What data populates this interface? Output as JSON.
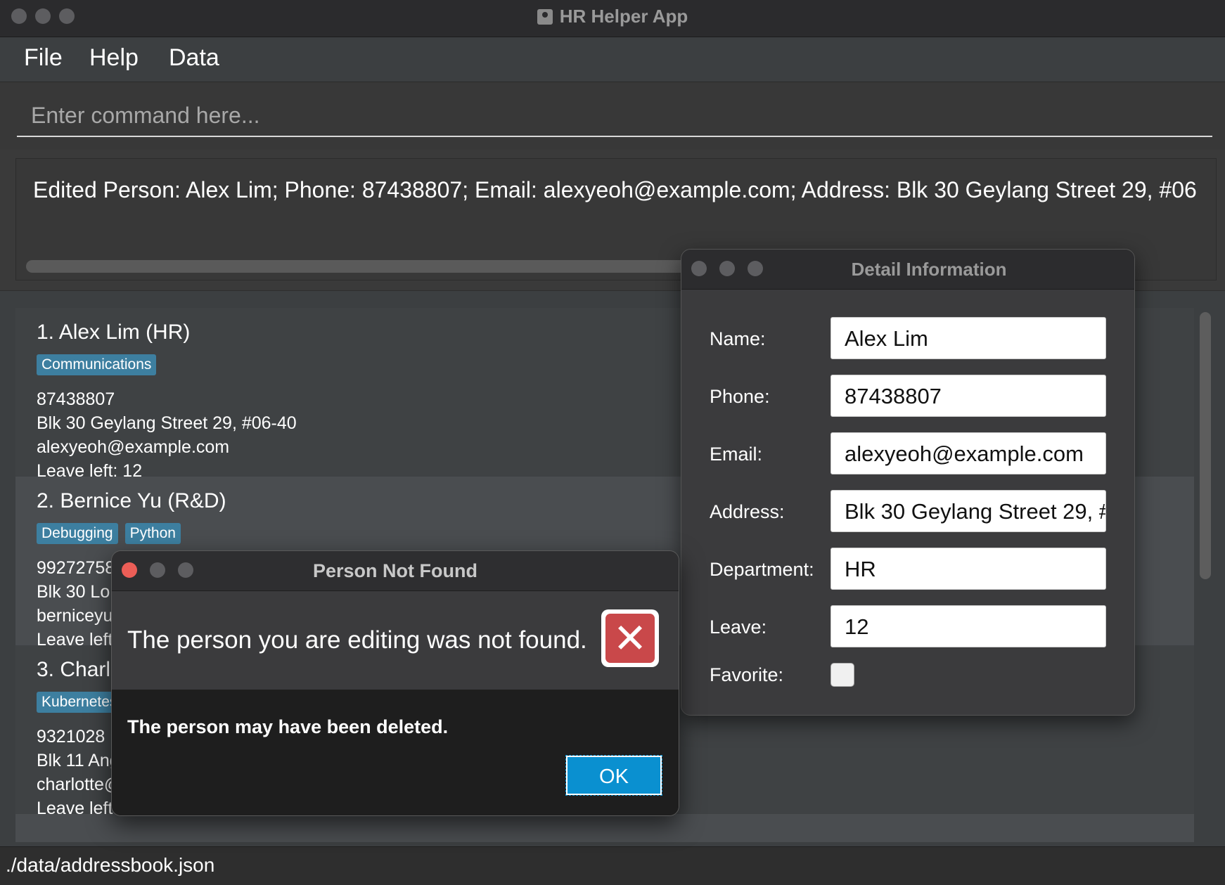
{
  "window": {
    "title": "HR Helper App"
  },
  "menu": {
    "items": [
      "File",
      "Help",
      "Data"
    ]
  },
  "command": {
    "placeholder": "Enter command here..."
  },
  "result": {
    "text": "Edited Person: Alex Lim; Phone: 87438807; Email: alexyeoh@example.com; Address: Blk 30 Geylang Street 29, #06"
  },
  "persons": [
    {
      "title": "1. Alex Lim  (HR)",
      "tags": [
        "Communications"
      ],
      "phone": "87438807",
      "address": "Blk 30 Geylang Street 29, #06-40",
      "email": "alexyeoh@example.com",
      "leave": "Leave left: 12"
    },
    {
      "title": "2. Bernice Yu  (R&D)",
      "tags": [
        "Debugging",
        "Python"
      ],
      "phone": "99272758",
      "address": "Blk 30 Lo",
      "email": "berniceyu",
      "leave": "Leave left"
    },
    {
      "title": "3. Charl",
      "tags": [
        "Kubernetes"
      ],
      "phone": "9321028",
      "address": "Blk 11 Ang",
      "email": "charlotte@",
      "leave": "Leave left"
    }
  ],
  "status": {
    "path": "./data/addressbook.json"
  },
  "detail": {
    "title": "Detail Information",
    "labels": {
      "name": "Name:",
      "phone": "Phone:",
      "email": "Email:",
      "address": "Address:",
      "department": "Department:",
      "leave": "Leave:",
      "favorite": "Favorite:"
    },
    "values": {
      "name": "Alex Lim",
      "phone": "87438807",
      "email": "alexyeoh@example.com",
      "address": "Blk 30 Geylang Street 29, #06-40",
      "department": "HR",
      "leave": "12",
      "favorite": false
    }
  },
  "alert": {
    "title": "Person Not Found",
    "header": "The person you are editing was not found.",
    "content": "The person may have been deleted.",
    "ok_label": "OK",
    "icon": "error-x-icon",
    "icon_color": "#c9484a"
  },
  "colors": {
    "accent": "#0a90d0",
    "tag": "#3d7fa0"
  }
}
